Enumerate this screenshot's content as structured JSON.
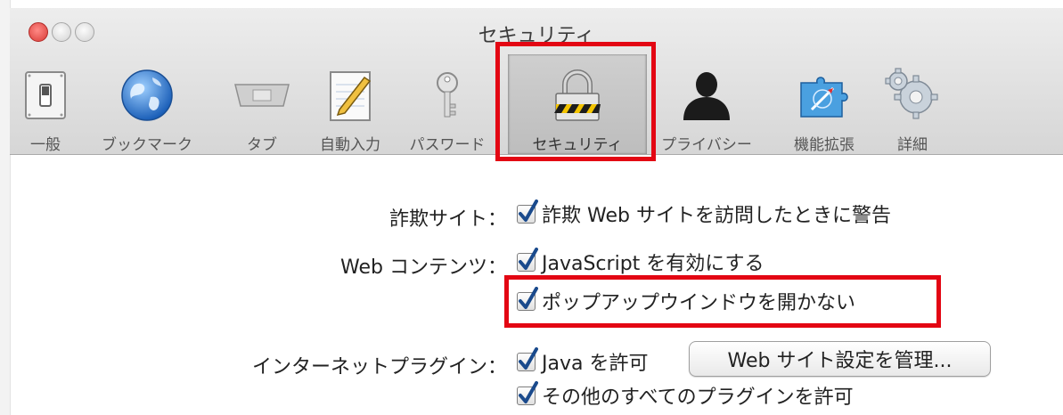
{
  "window": {
    "title": "セキュリティ"
  },
  "toolbar": {
    "tabs": [
      {
        "label": "一般",
        "icon": "switch-icon"
      },
      {
        "label": "ブックマーク",
        "icon": "globe-icon"
      },
      {
        "label": "タブ",
        "icon": "tabs-icon"
      },
      {
        "label": "自動入力",
        "icon": "pencil-notepad-icon"
      },
      {
        "label": "パスワード",
        "icon": "key-icon"
      },
      {
        "label": "セキュリティ",
        "icon": "padlock-icon",
        "selected": true
      },
      {
        "label": "プライバシー",
        "icon": "person-silhouette-icon"
      },
      {
        "label": "機能拡張",
        "icon": "compass-puzzle-icon"
      },
      {
        "label": "詳細",
        "icon": "gears-icon"
      }
    ]
  },
  "settings": {
    "fraud": {
      "label": "詐欺サイト：",
      "option": {
        "text": "詐欺 Web サイトを訪問したときに警告",
        "checked": true
      }
    },
    "web_content": {
      "label": "Web コンテンツ：",
      "options": [
        {
          "text": "JavaScript を有効にする",
          "checked": true
        },
        {
          "text": "ポップアップウインドウを開かない",
          "checked": true
        }
      ]
    },
    "plugins": {
      "label": "インターネットプラグイン：",
      "options": [
        {
          "text": "Java を許可",
          "checked": true
        },
        {
          "text": "その他のすべてのプラグインを許可",
          "checked": true
        }
      ],
      "manage_button": "Web サイト設定を管理..."
    }
  },
  "colors": {
    "highlight_box": "#e30613",
    "checkmark": "#1a4a8c",
    "toolbar_top": "#ededed",
    "toolbar_bottom": "#d6d6d6"
  }
}
